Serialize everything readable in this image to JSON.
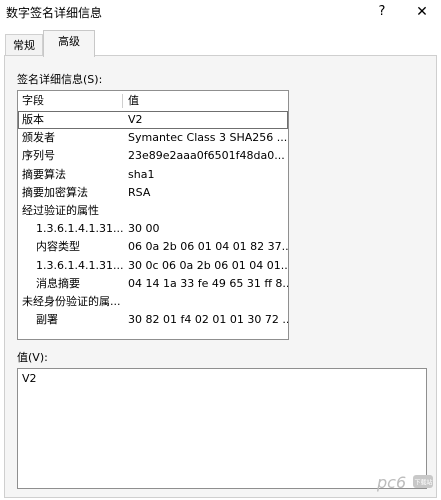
{
  "window": {
    "title": "数字签名详细信息",
    "help": "?",
    "close": "✕"
  },
  "tabs": [
    {
      "label": "常规"
    },
    {
      "label": "高级"
    }
  ],
  "details_label": "签名详细信息(S):",
  "list": {
    "columns": {
      "field": "字段",
      "value": "值"
    },
    "rows": [
      {
        "field": "版本",
        "value": "V2",
        "indent": 0,
        "selected": true
      },
      {
        "field": "颁发者",
        "value": "Symantec Class 3 SHA256 ...",
        "indent": 0
      },
      {
        "field": "序列号",
        "value": "23e89e2aaa0f6501f48da0...",
        "indent": 0
      },
      {
        "field": "摘要算法",
        "value": "sha1",
        "indent": 0
      },
      {
        "field": "摘要加密算法",
        "value": "RSA",
        "indent": 0
      },
      {
        "field": "经过验证的属性",
        "value": "",
        "indent": 0
      },
      {
        "field": "1.3.6.1.4.1.31...",
        "value": "30 00",
        "indent": 1
      },
      {
        "field": "内容类型",
        "value": "06 0a 2b 06 01 04 01 82 37...",
        "indent": 1
      },
      {
        "field": "1.3.6.1.4.1.31...",
        "value": "30 0c 06 0a 2b 06 01 04 01...",
        "indent": 1
      },
      {
        "field": "消息摘要",
        "value": "04 14 1a 33 fe 49 65 31 ff 8...",
        "indent": 1
      },
      {
        "field": "未经身份验证的属...",
        "value": "",
        "indent": 0
      },
      {
        "field": "副署",
        "value": "30 82 01 f4 02 01 01 30 72 ...",
        "indent": 1
      }
    ]
  },
  "value_label": "值(V):",
  "value_text": "V2",
  "watermark": {
    "text": "pc6",
    "sub": "下载站",
    "color": "#b9b9b9"
  }
}
